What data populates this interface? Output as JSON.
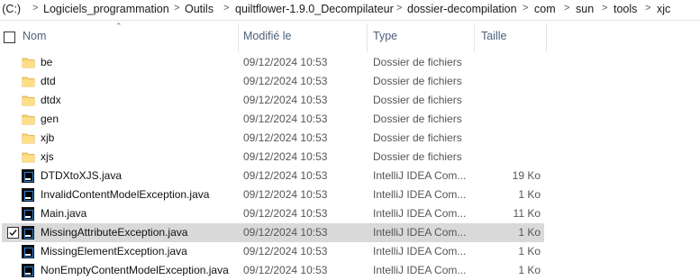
{
  "breadcrumb": {
    "items": [
      "l (C:)",
      "Logiciels_programmation",
      "Outils",
      "quiltflower-1.9.0_Decompilateur",
      "dossier-decompilation",
      "com",
      "sun",
      "tools",
      "xjc"
    ],
    "separator": ">"
  },
  "columns": {
    "name": "Nom",
    "modified": "Modifié le",
    "type": "Type",
    "size": "Taille"
  },
  "files": [
    {
      "name": "be",
      "date": "09/12/2024 10:53",
      "type": "Dossier de fichiers",
      "size": "",
      "icon": "folder-icon"
    },
    {
      "name": "dtd",
      "date": "09/12/2024 10:53",
      "type": "Dossier de fichiers",
      "size": "",
      "icon": "folder-icon"
    },
    {
      "name": "dtdx",
      "date": "09/12/2024 10:53",
      "type": "Dossier de fichiers",
      "size": "",
      "icon": "folder-icon"
    },
    {
      "name": "gen",
      "date": "09/12/2024 10:53",
      "type": "Dossier de fichiers",
      "size": "",
      "icon": "folder-icon"
    },
    {
      "name": "xjb",
      "date": "09/12/2024 10:53",
      "type": "Dossier de fichiers",
      "size": "",
      "icon": "folder-icon"
    },
    {
      "name": "xjs",
      "date": "09/12/2024 10:53",
      "type": "Dossier de fichiers",
      "size": "",
      "icon": "folder-icon"
    },
    {
      "name": "DTDXtoXJS.java",
      "date": "09/12/2024 10:53",
      "type": "IntelliJ IDEA Com...",
      "size": "19 Ko",
      "icon": "intellij-file-icon"
    },
    {
      "name": "InvalidContentModelException.java",
      "date": "09/12/2024 10:53",
      "type": "IntelliJ IDEA Com...",
      "size": "1 Ko",
      "icon": "intellij-file-icon"
    },
    {
      "name": "Main.java",
      "date": "09/12/2024 10:53",
      "type": "IntelliJ IDEA Com...",
      "size": "11 Ko",
      "icon": "intellij-file-icon"
    },
    {
      "name": "MissingAttributeException.java",
      "date": "09/12/2024 10:53",
      "type": "IntelliJ IDEA Com...",
      "size": "1 Ko",
      "icon": "intellij-file-icon",
      "selected": true
    },
    {
      "name": "MissingElementException.java",
      "date": "09/12/2024 10:53",
      "type": "IntelliJ IDEA Com...",
      "size": "1 Ko",
      "icon": "intellij-file-icon"
    },
    {
      "name": "NonEmptyContentModelException.java",
      "date": "09/12/2024 10:53",
      "type": "IntelliJ IDEA Com...",
      "size": "1 Ko",
      "icon": "intellij-file-icon"
    }
  ],
  "colors": {
    "selected_row": "#d9d9d9",
    "folder": "#f8d775",
    "header_text": "#4c607a"
  }
}
